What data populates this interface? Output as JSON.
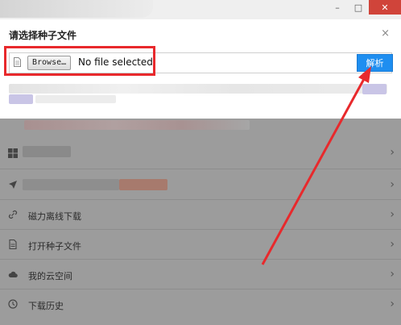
{
  "titlebar": {
    "minimize_glyph": "–",
    "maximize_glyph": "□",
    "close_glyph": "✕"
  },
  "dialog": {
    "title": "请选择种子文件",
    "close_glyph": "×",
    "browse_label": "Browse…",
    "file_status": "No file selected.",
    "parse_label": "解析"
  },
  "list": {
    "items": [
      {
        "icon": "windows-icon",
        "label": ""
      },
      {
        "icon": "send-icon",
        "label": ""
      },
      {
        "icon": "magnet-link-icon",
        "label": "磁力离线下载"
      },
      {
        "icon": "torrent-file-icon",
        "label": "打开种子文件"
      },
      {
        "icon": "cloud-icon",
        "label": "我的云空间"
      },
      {
        "icon": "history-icon",
        "label": "下载历史"
      }
    ],
    "chevron": "›"
  },
  "colors": {
    "highlight_red": "#e8292c",
    "parse_blue": "#1e8ef0",
    "dim_gray": "#9c9c9c"
  }
}
